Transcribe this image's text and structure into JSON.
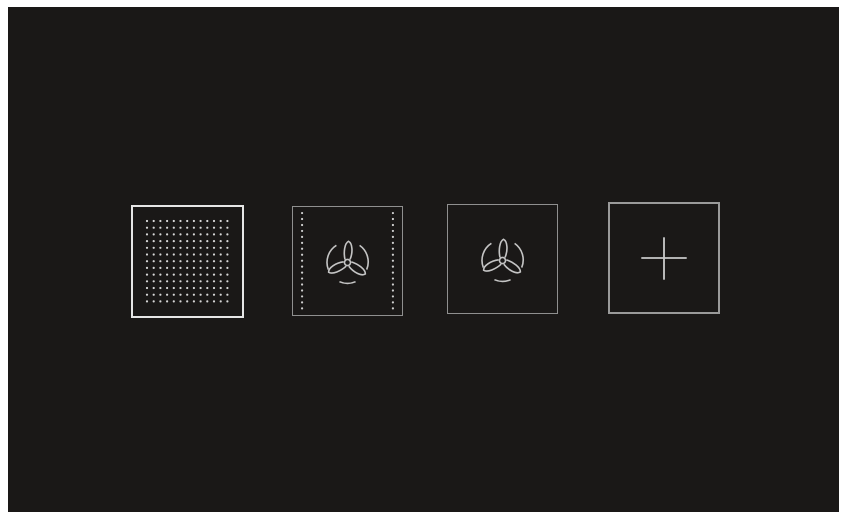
{
  "controls": [
    {
      "id": "grid",
      "icon": "dot-grid-icon",
      "color": "#e6e6e6"
    },
    {
      "id": "fan_a",
      "icon": "fan-dotted-icon",
      "color": "#b5b5b5"
    },
    {
      "id": "fan_b",
      "icon": "fan-icon",
      "color": "#b5b5b5"
    },
    {
      "id": "add",
      "icon": "plus-icon",
      "color": "#bdbdbd"
    }
  ],
  "colors": {
    "background": "#1a1817",
    "frame": "#ffffff"
  }
}
